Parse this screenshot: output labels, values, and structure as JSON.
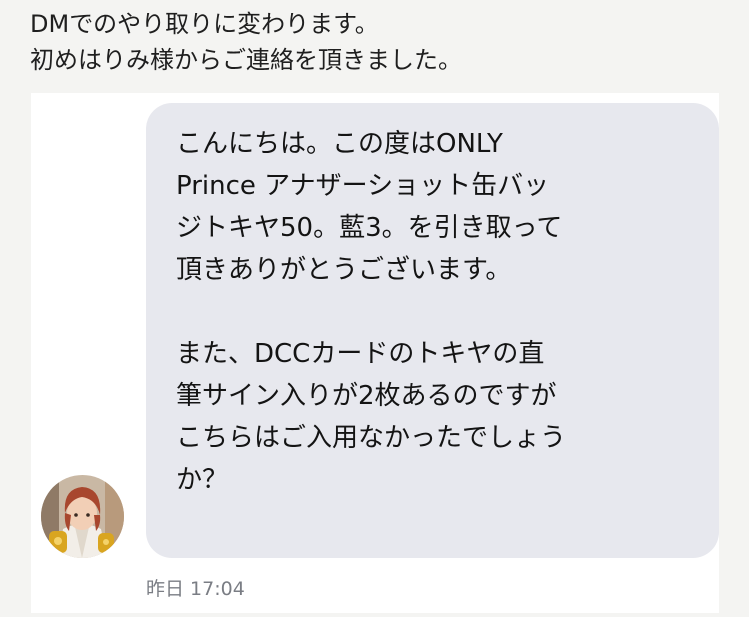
{
  "intro": {
    "line1": "DMでのやり取りに変わります。",
    "line2": "初めはりみ様からご連絡を頂きました。"
  },
  "message": {
    "lines": [
      "こんにちは。この度はONLY",
      "Prince アナザーショット缶バッ",
      "ジトキヤ50。藍3。を引き取って",
      "頂きありがとうございます。",
      "",
      "また、DCCカードのトキヤの直",
      "筆サイン入りが2枚あるのですが",
      "こちらはご入用なかったでしょう",
      "か？"
    ],
    "timestamp": "昨日 17:04"
  },
  "avatar": {
    "icon": "character-avatar-icon",
    "colors": {
      "hair": "#a8472e",
      "clothes": "#f2eee8",
      "gold": "#d9a520",
      "background": "#c9b8a4"
    }
  },
  "colors": {
    "page_background": "#f4f4f2",
    "card_background": "#ffffff",
    "bubble_background": "#e7e8ee",
    "timestamp_text": "#7a7d84"
  }
}
